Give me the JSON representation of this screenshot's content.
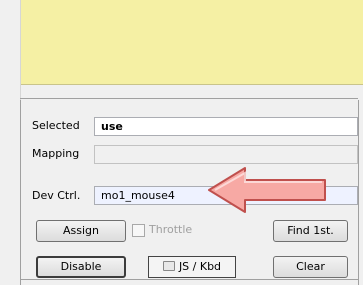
{
  "fields": {
    "selected": {
      "label": "Selected",
      "value": "use"
    },
    "mapping": {
      "label": "Mapping",
      "value": ""
    },
    "dev_ctrl": {
      "label": "Dev Ctrl.",
      "value": "mo1_mouse4"
    }
  },
  "buttons": {
    "assign": "Assign",
    "find_first": "Find 1st.",
    "disable": "Disable",
    "js_kbd": "JS / Kbd",
    "clear": "Clear"
  },
  "throttle": {
    "label": "Throttle",
    "checked": false
  },
  "icons": {
    "arrow": "red-arrow-left",
    "kbd": "keyboard-icon"
  },
  "colors": {
    "panel": "#f5f0a4",
    "arrow_fill": "#f7a9a4",
    "arrow_stroke": "#c0504d"
  }
}
